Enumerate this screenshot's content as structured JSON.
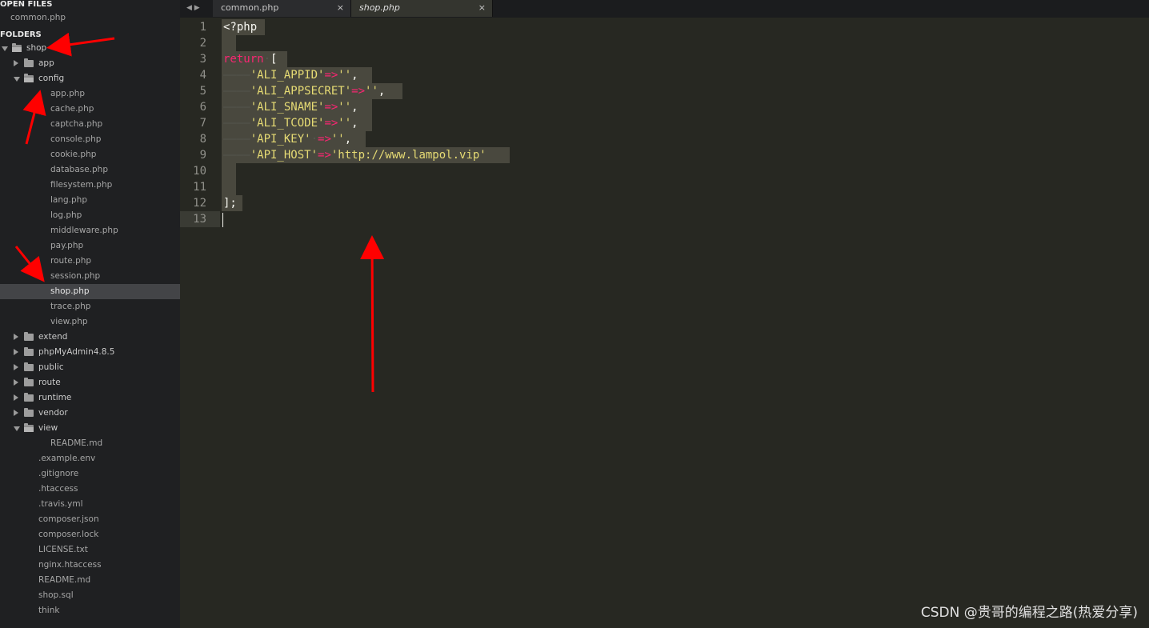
{
  "sidebar": {
    "open_files_header": "OPEN FILES",
    "open_files": [
      "common.php"
    ],
    "folders_header": "FOLDERS",
    "tree": [
      {
        "label": "shop",
        "kind": "folder",
        "state": "open",
        "depth": 0
      },
      {
        "label": "app",
        "kind": "folder",
        "state": "closed",
        "depth": 1
      },
      {
        "label": "config",
        "kind": "folder",
        "state": "open",
        "depth": 1
      },
      {
        "label": "app.php",
        "kind": "file",
        "depth": 2
      },
      {
        "label": "cache.php",
        "kind": "file",
        "depth": 2
      },
      {
        "label": "captcha.php",
        "kind": "file",
        "depth": 2
      },
      {
        "label": "console.php",
        "kind": "file",
        "depth": 2
      },
      {
        "label": "cookie.php",
        "kind": "file",
        "depth": 2
      },
      {
        "label": "database.php",
        "kind": "file",
        "depth": 2
      },
      {
        "label": "filesystem.php",
        "kind": "file",
        "depth": 2
      },
      {
        "label": "lang.php",
        "kind": "file",
        "depth": 2
      },
      {
        "label": "log.php",
        "kind": "file",
        "depth": 2
      },
      {
        "label": "middleware.php",
        "kind": "file",
        "depth": 2
      },
      {
        "label": "pay.php",
        "kind": "file",
        "depth": 2
      },
      {
        "label": "route.php",
        "kind": "file",
        "depth": 2
      },
      {
        "label": "session.php",
        "kind": "file",
        "depth": 2
      },
      {
        "label": "shop.php",
        "kind": "file",
        "depth": 2,
        "selected": true
      },
      {
        "label": "trace.php",
        "kind": "file",
        "depth": 2
      },
      {
        "label": "view.php",
        "kind": "file",
        "depth": 2
      },
      {
        "label": "extend",
        "kind": "folder",
        "state": "closed",
        "depth": 1
      },
      {
        "label": "phpMyAdmin4.8.5",
        "kind": "folder",
        "state": "closed",
        "depth": 1
      },
      {
        "label": "public",
        "kind": "folder",
        "state": "closed",
        "depth": 1
      },
      {
        "label": "route",
        "kind": "folder",
        "state": "closed",
        "depth": 1
      },
      {
        "label": "runtime",
        "kind": "folder",
        "state": "closed",
        "depth": 1
      },
      {
        "label": "vendor",
        "kind": "folder",
        "state": "closed",
        "depth": 1
      },
      {
        "label": "view",
        "kind": "folder",
        "state": "open",
        "depth": 1
      },
      {
        "label": "README.md",
        "kind": "file",
        "depth": 2
      },
      {
        "label": ".example.env",
        "kind": "file",
        "depth": 1
      },
      {
        "label": ".gitignore",
        "kind": "file",
        "depth": 1
      },
      {
        "label": ".htaccess",
        "kind": "file",
        "depth": 1
      },
      {
        "label": ".travis.yml",
        "kind": "file",
        "depth": 1
      },
      {
        "label": "composer.json",
        "kind": "file",
        "depth": 1
      },
      {
        "label": "composer.lock",
        "kind": "file",
        "depth": 1
      },
      {
        "label": "LICENSE.txt",
        "kind": "file",
        "depth": 1
      },
      {
        "label": "nginx.htaccess",
        "kind": "file",
        "depth": 1
      },
      {
        "label": "README.md",
        "kind": "file",
        "depth": 1
      },
      {
        "label": "shop.sql",
        "kind": "file",
        "depth": 1
      },
      {
        "label": "think",
        "kind": "file",
        "depth": 1
      }
    ]
  },
  "tabs": [
    {
      "label": "common.php",
      "active": false,
      "close": "×"
    },
    {
      "label": "shop.php",
      "active": true,
      "close": "×"
    }
  ],
  "nav_arrows": "◀ ▶",
  "editor": {
    "line_numbers": [
      "1",
      "2",
      "3",
      "4",
      "5",
      "6",
      "7",
      "8",
      "9",
      "10",
      "11",
      "12",
      "13"
    ],
    "lines": [
      [
        {
          "t": "<?php",
          "c": "plain"
        }
      ],
      [],
      [
        {
          "t": "return",
          "c": "kw"
        },
        {
          "t": "·",
          "c": "guide"
        },
        {
          "t": "[",
          "c": "plain"
        }
      ],
      [
        {
          "t": "————",
          "c": "guide"
        },
        {
          "t": "'ALI_APPID'",
          "c": "str"
        },
        {
          "t": "=>",
          "c": "op"
        },
        {
          "t": "''",
          "c": "str"
        },
        {
          "t": ",",
          "c": "plain"
        }
      ],
      [
        {
          "t": "————",
          "c": "guide"
        },
        {
          "t": "'ALI_APPSECRET'",
          "c": "str"
        },
        {
          "t": "=>",
          "c": "op"
        },
        {
          "t": "''",
          "c": "str"
        },
        {
          "t": ",",
          "c": "plain"
        }
      ],
      [
        {
          "t": "————",
          "c": "guide"
        },
        {
          "t": "'ALI_SNAME'",
          "c": "str"
        },
        {
          "t": "=>",
          "c": "op"
        },
        {
          "t": "''",
          "c": "str"
        },
        {
          "t": ",",
          "c": "plain"
        }
      ],
      [
        {
          "t": "————",
          "c": "guide"
        },
        {
          "t": "'ALI_TCODE'",
          "c": "str"
        },
        {
          "t": "=>",
          "c": "op"
        },
        {
          "t": "''",
          "c": "str"
        },
        {
          "t": ",",
          "c": "plain"
        }
      ],
      [
        {
          "t": "————",
          "c": "guide"
        },
        {
          "t": "'API_KEY'",
          "c": "str"
        },
        {
          "t": "·",
          "c": "guide"
        },
        {
          "t": "=>",
          "c": "op"
        },
        {
          "t": "''",
          "c": "str"
        },
        {
          "t": ",",
          "c": "plain"
        }
      ],
      [
        {
          "t": "————",
          "c": "guide"
        },
        {
          "t": "'API_HOST'",
          "c": "str"
        },
        {
          "t": "=>",
          "c": "op"
        },
        {
          "t": "'http://www.lampol.vip'",
          "c": "str"
        }
      ],
      [],
      [],
      [
        {
          "t": "];",
          "c": "plain"
        }
      ],
      []
    ]
  },
  "watermark": "CSDN @贵哥的编程之路(热爱分享)",
  "colors": {
    "annotation_arrow": "#ff0000",
    "selection": "#49483e",
    "keyword": "#f92672",
    "string": "#e6db74"
  }
}
